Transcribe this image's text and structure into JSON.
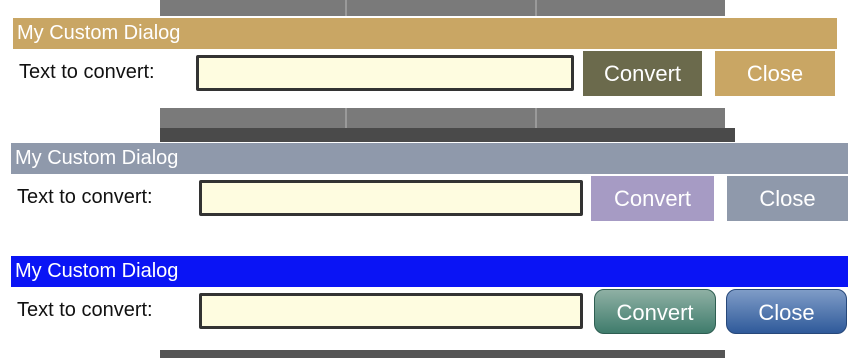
{
  "dialogs": [
    {
      "title": "My Custom Dialog",
      "label": "Text to convert:",
      "input_value": "",
      "convert_label": "Convert",
      "close_label": "Close",
      "colors": {
        "title_bar": "#c9a664",
        "convert": "#6b6a4c",
        "close": "#c9a664"
      }
    },
    {
      "title": "My Custom Dialog",
      "label": "Text to convert:",
      "input_value": "",
      "convert_label": "Convert",
      "close_label": "Close",
      "colors": {
        "title_bar": "#8f99ab",
        "convert": "#a69bc4",
        "close": "#8f99ab"
      }
    },
    {
      "title": "My Custom Dialog",
      "label": "Text to convert:",
      "input_value": "",
      "convert_label": "Convert",
      "close_label": "Close",
      "colors": {
        "title_bar": "#0a14f5",
        "convert": "#3f7c6c",
        "close": "#2f5a9a"
      }
    }
  ]
}
